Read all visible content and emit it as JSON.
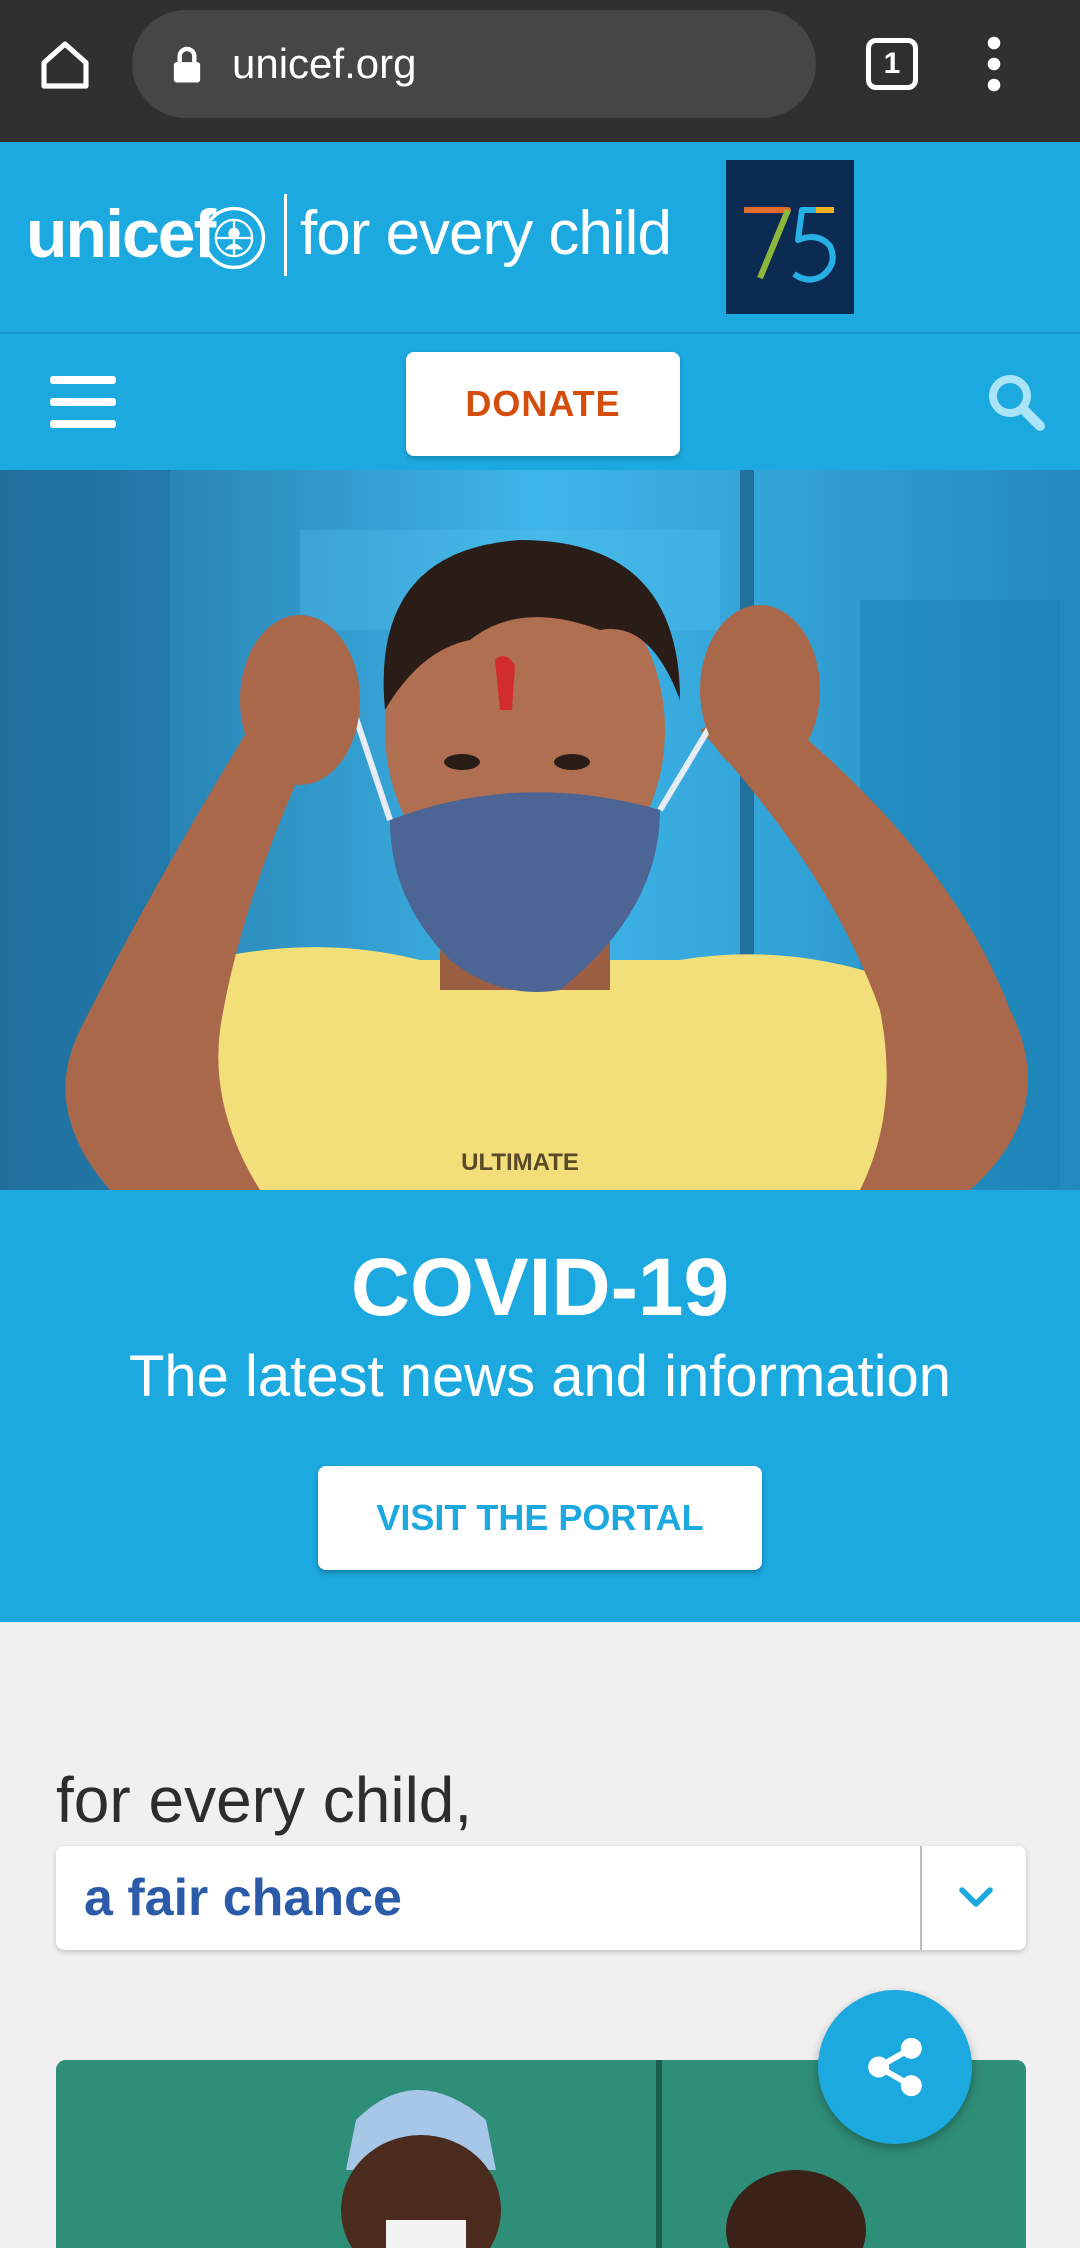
{
  "browser": {
    "url": "unicef.org",
    "tab_count": "1"
  },
  "header": {
    "logo_text": "unicef",
    "tagline": "for every child",
    "anniversary": "75"
  },
  "nav": {
    "donate_label": "DONATE"
  },
  "covid": {
    "title": "COVID-19",
    "subtitle": "The latest news and information",
    "button_label": "VISIT THE PORTAL"
  },
  "for_every_child": {
    "label": "for every child,",
    "selected": "a fair chance"
  },
  "colors": {
    "brand_blue": "#1ca9e0",
    "donate_orange": "#d34d0d",
    "select_text": "#2b5aa8",
    "browser_bar": "#303030"
  },
  "icons": {
    "home": "home-icon",
    "lock": "lock-icon",
    "tabs": "tabs-icon",
    "menu": "more-vert-icon",
    "hamburger": "hamburger-icon",
    "search": "search-icon",
    "chevron": "chevron-down-icon",
    "share": "share-icon"
  }
}
